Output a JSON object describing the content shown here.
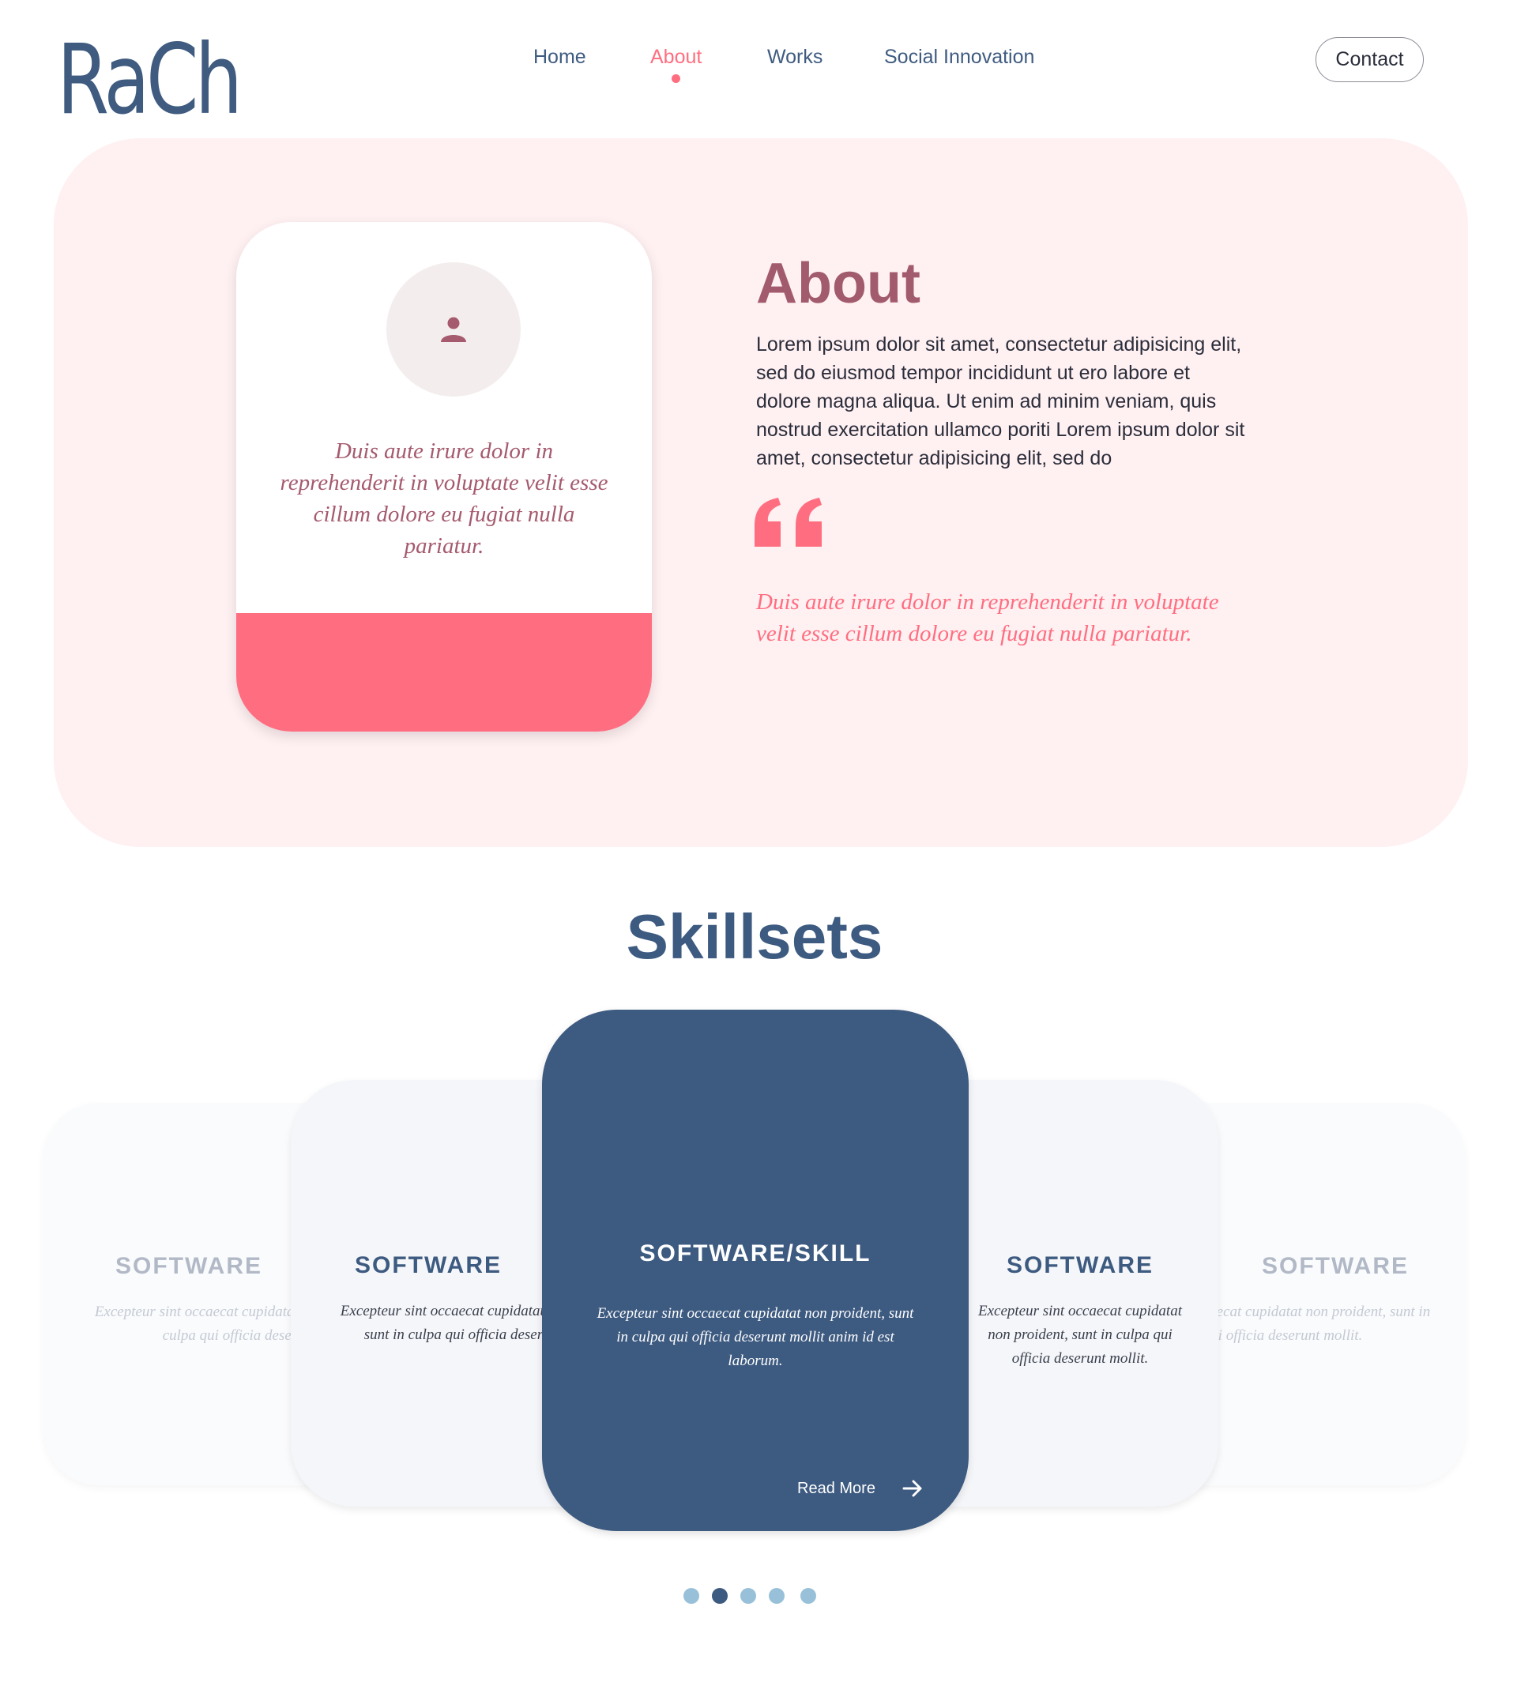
{
  "header": {
    "logo": "RaCh",
    "nav": [
      {
        "label": "Home"
      },
      {
        "label": "About",
        "active": true
      },
      {
        "label": "Works"
      },
      {
        "label": "Social Innovation"
      }
    ],
    "contact_label": "Contact"
  },
  "about": {
    "card_quote": "Duis aute irure dolor in reprehenderit in voluptate velit esse cillum dolore eu fugiat nulla pariatur.",
    "title": "About",
    "body": "Lorem ipsum dolor sit amet, consectetur adipisicing elit, sed do eiusmod tempor incididunt ut ero labore et dolore magna aliqua. Ut enim ad minim veniam, quis nostrud exercitation ullamco poriti Lorem ipsum dolor sit amet, consectetur adipisicing elit, sed do",
    "quote": "Duis aute irure dolor in reprehenderit in voluptate velit esse cillum dolore eu fugiat nulla pariatur.",
    "colors": {
      "accent": "#ff6e80",
      "title": "#a25b6d",
      "section_bg": "#fff0f2"
    },
    "avatar_icon": "user-icon",
    "quote_icon": "quote-mark-icon"
  },
  "skills": {
    "title": "Skillsets",
    "cards": [
      {
        "title": "SOFTWARE",
        "desc": "Excepteur sint occaecat cupidatat non proident, sunt in culpa qui officia deserunt mollit."
      },
      {
        "title": "SOFTWARE",
        "desc": "Excepteur sint occaecat cupidatat non proident, sunt in culpa qui officia deserunt mollit."
      },
      {
        "title": "SOFTWARE/SKILL",
        "desc": "Excepteur sint occaecat cupidatat non proident, sunt in culpa qui officia deserunt mollit anim id est laborum.",
        "read_more": "Read More"
      },
      {
        "title": "SOFTWARE",
        "desc": "Excepteur sint occaecat cupidatat non proident, sunt in culpa qui officia deserunt mollit."
      },
      {
        "title": "SOFTWARE",
        "desc": "Excepteur sint occaecat cupidatat non proident, sunt in culpa qui officia deserunt mollit."
      }
    ],
    "carousel": {
      "count": 5,
      "active_index": 1
    },
    "colors": {
      "primary": "#3d5a80",
      "dot": "#98c1d9"
    }
  }
}
